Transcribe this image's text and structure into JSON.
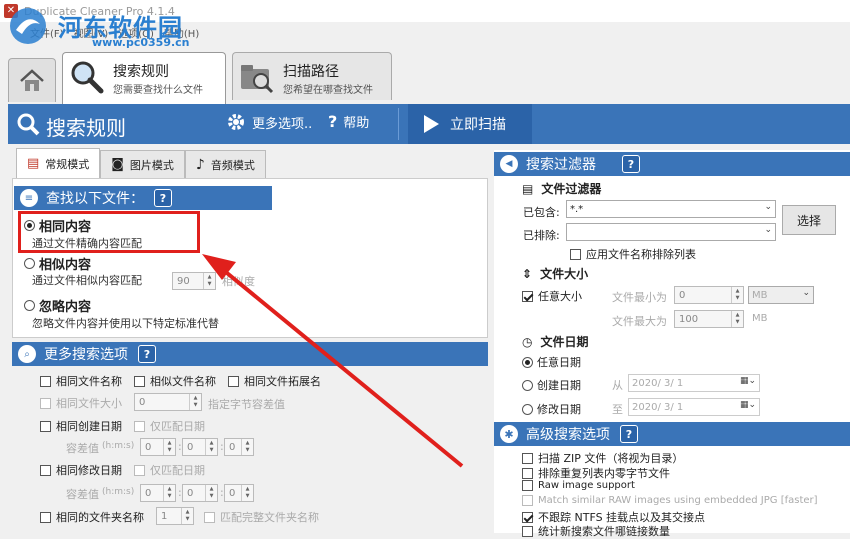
{
  "window": {
    "title": "Duplicate Cleaner Pro 4.1.4"
  },
  "watermark": {
    "site": "河东软件园",
    "url": "www.pc0359.cn"
  },
  "menu": {
    "items": [
      "文件(F)",
      "视图(V)",
      "选项(O)",
      "帮助(H)"
    ]
  },
  "tabs": [
    {
      "title": "搜索规则",
      "subtitle": "您需要查找什么文件"
    },
    {
      "title": "扫描路径",
      "subtitle": "您希望在哪查找文件"
    }
  ],
  "toolbar": {
    "title": "搜索规则",
    "more": "更多选项..",
    "help": "帮助",
    "scan": "立即扫描"
  },
  "modes": [
    "常规模式",
    "图片模式",
    "音频模式"
  ],
  "find": {
    "header": "查找以下文件：",
    "same": {
      "label": "相同内容",
      "desc": "通过文件精确内容匹配"
    },
    "similar": {
      "label": "相似内容",
      "desc": "通过文件相似内容匹配",
      "value": "90",
      "suffix": "相似度"
    },
    "ignore": {
      "label": "忽略内容",
      "desc": "忽略文件内容并使用以下特定标准代替"
    }
  },
  "more": {
    "header": "更多搜索选项",
    "same_name": "相同文件名称",
    "similar_name": "相似文件名称",
    "same_ext": "相同文件拓展名",
    "same_size": "相同文件大小",
    "size_val": "0",
    "size_note": "指定字节容差值",
    "same_created": "相同创建日期",
    "date_only1": "仅匹配日期",
    "tol1": "容差值",
    "tol_fmt": "(h:m:s)",
    "zero": "0",
    "sep": ":",
    "same_modified": "相同修改日期",
    "date_only2": "仅匹配日期",
    "same_folder": "相同的文件夹名称",
    "folder_val": "1",
    "full_folder": "匹配完整文件夹名称"
  },
  "filters": {
    "header": "搜索过滤器",
    "file_filter": "文件过滤器",
    "include_label": "已包含:",
    "include_val": "*.*",
    "exclude_label": "已排除:",
    "exclude_val": "",
    "choose": "选择",
    "apply_exclude": "应用文件名称排除列表",
    "file_size": "文件大小",
    "any_size": "任意大小",
    "min_label": "文件最小为",
    "min_val": "0",
    "unit1": "MB",
    "max_label": "文件最大为",
    "max_val": "100",
    "unit2": "MB",
    "file_date": "文件日期",
    "any_date": "任意日期",
    "created": "创建日期",
    "from": "从",
    "d1": "2020/ 3/ 1",
    "modified": "修改日期",
    "to": "至",
    "d2": "2020/ 3/ 1"
  },
  "advanced": {
    "header": "高级搜索选项",
    "items": [
      {
        "label": "扫描 ZIP 文件（将视为目录）",
        "checked": false,
        "disabled": false
      },
      {
        "label": "排除重复列表内零字节文件",
        "checked": false,
        "disabled": false
      },
      {
        "label": "Raw image support",
        "checked": false,
        "disabled": false
      },
      {
        "label": "Match similar RAW images using embedded JPG [faster]",
        "checked": false,
        "disabled": true
      },
      {
        "label": "不跟踪 NTFS 挂载点以及其交接点",
        "checked": true,
        "disabled": false
      },
      {
        "label": "统计新搜索文件哪链接数量",
        "checked": false,
        "disabled": false
      }
    ]
  },
  "colors": {
    "accent": "#3a74b8",
    "highlight": "#e0201c"
  }
}
